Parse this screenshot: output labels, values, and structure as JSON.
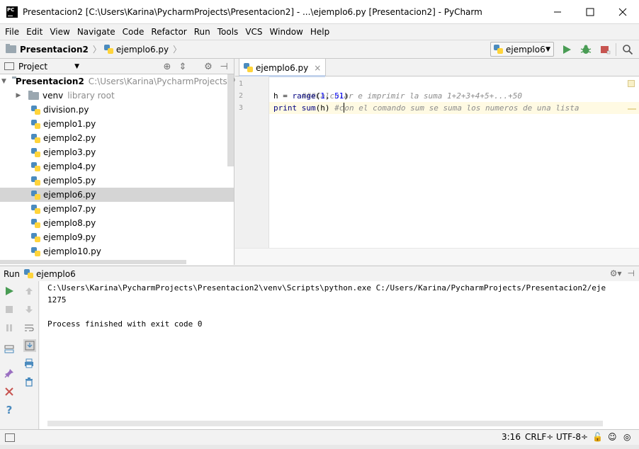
{
  "window": {
    "title": "Presentacion2 [C:\\Users\\Karina\\PycharmProjects\\Presentacion2] - ...\\ejemplo6.py [Presentacion2] - PyCharm"
  },
  "menu": [
    "File",
    "Edit",
    "View",
    "Navigate",
    "Code",
    "Refactor",
    "Run",
    "Tools",
    "VCS",
    "Window",
    "Help"
  ],
  "nav": {
    "project": "Presentacion2",
    "file": "ejemplo6.py",
    "run_config": "ejemplo6"
  },
  "project_panel": {
    "title": "Project",
    "root": {
      "name": "Presentacion2",
      "path": "C:\\Users\\Karina\\PycharmProjects\\Prese"
    },
    "venv": {
      "name": "venv",
      "tag": "library root"
    },
    "files": [
      "division.py",
      "ejemplo1.py",
      "ejemplo2.py",
      "ejemplo3.py",
      "ejemplo4.py",
      "ejemplo5.py",
      "ejemplo6.py",
      "ejemplo7.py",
      "ejemplo8.py",
      "ejemplo9.py",
      "ejemplo10.py"
    ],
    "selected_file": "ejemplo6.py"
  },
  "editor": {
    "tab": "ejemplo6.py",
    "line_numbers": [
      "1",
      "2",
      "3"
    ],
    "line1": "###Calcular e imprimir la suma 1+2+3+4+5+...+50",
    "line2": {
      "var": "h = ",
      "fn": "range",
      "open": "(",
      "a": "1",
      "mid": ", ",
      "b": "51",
      "close": ")"
    },
    "line3": {
      "kw": "print ",
      "fn": "sum",
      "args": "(h) ",
      "comment_a": "#c",
      "comment_b": "on el comando sum se suma los numeros de una lista"
    }
  },
  "run": {
    "label": "Run",
    "config": "ejemplo6",
    "output": [
      "C:\\Users\\Karina\\PycharmProjects\\Presentacion2\\venv\\Scripts\\python.exe C:/Users/Karina/PycharmProjects/Presentacion2/eje",
      "1275",
      "",
      "Process finished with exit code 0"
    ]
  },
  "status": {
    "position": "3:16",
    "line_sep": "CRLF÷",
    "encoding": "UTF-8÷"
  },
  "colors": {
    "run_green": "#499c54",
    "stop_red": "#c75450",
    "selection": "#d5d5d5"
  }
}
